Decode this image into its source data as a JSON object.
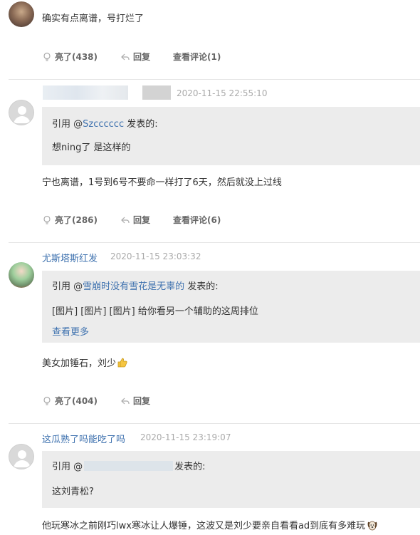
{
  "comments": [
    {
      "text": "确实有点离谱，号打烂了",
      "actions": {
        "like": "亮了(438)",
        "reply": "回复",
        "view": "查看评论(1)"
      }
    },
    {
      "time": "2020-11-15 22:55:10",
      "quote": {
        "prefix": "引用 @",
        "user": "Szcccccc",
        "suffix": " 发表的:",
        "content": "想ning了 是这样的"
      },
      "text": "宁也离谱，1号到6号不要命一样打了6天，然后就没上过线",
      "actions": {
        "like": "亮了(286)",
        "reply": "回复",
        "view": "查看评论(6)"
      }
    },
    {
      "user": "尤斯塔斯红发",
      "time": "2020-11-15 23:03:32",
      "quote": {
        "prefix": "引用 @",
        "user": "雪崩时没有雪花是无辜的",
        "suffix": " 发表的:",
        "content": "[图片] [图片] [图片] 给你看另一个辅助的这周排位",
        "more": "查看更多"
      },
      "text": "美女加锤石，刘少",
      "actions": {
        "like": "亮了(404)",
        "reply": "回复"
      }
    },
    {
      "user": "这瓜熟了吗能吃了吗",
      "time": "2020-11-15 23:19:07",
      "quote": {
        "prefix": "引用 @",
        "suffix": " 发表的:",
        "content": "这刘青松?"
      },
      "text": "他玩寒冰之前刚巧lwx寒冰让人爆锤，这波又是刘少要亲自看看ad到底有多难玩"
    }
  ],
  "colors": {
    "link": "#3f72af",
    "quote_bg": "#ececec",
    "time": "#aaaaaa"
  }
}
